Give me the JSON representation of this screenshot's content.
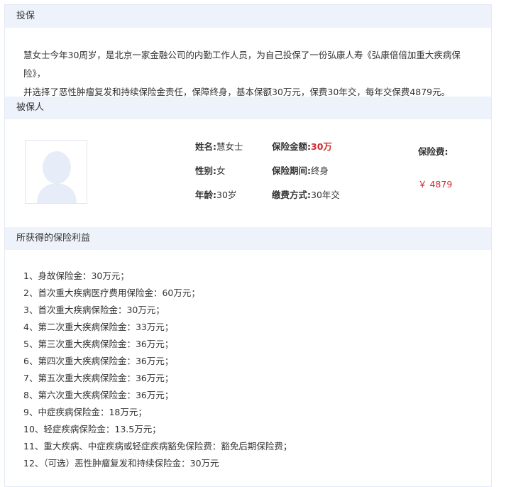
{
  "sections": {
    "toubao": "投保",
    "insured": "被保人",
    "benefits": "所获得的保险利益"
  },
  "intro": {
    "line1": "慧女士今年30周岁，是北京一家金融公司的内勤工作人员，为自己投保了一份弘康人寿《弘康倍倍加重大疾病保险》，",
    "line2": "并选择了恶性肿瘤复发和持续保险金责任，保障终身，基本保额30万元，保费30年交，每年交保费4879元。"
  },
  "insured": {
    "avatar_icon": "person-silhouette-icon",
    "name_label": "姓名:",
    "name_value": "慧女士",
    "gender_label": "性别:",
    "gender_value": "女",
    "age_label": "年龄:",
    "age_value": "30岁",
    "amount_label": "保险金额:",
    "amount_value": "30万",
    "period_label": "保险期间:",
    "period_value": "终身",
    "payment_label": "缴费方式:",
    "payment_value": "30年交",
    "fee_label": "保险费:",
    "fee_value": "￥ 4879"
  },
  "benefit_items": [
    "1、身故保险金：30万元；",
    "2、首次重大疾病医疗费用保险金：60万元；",
    "3、首次重大疾病保险金：30万元；",
    "4、第二次重大疾病保险金：33万元；",
    "5、第三次重大疾病保险金：36万元；",
    "6、第四次重大疾病保险金：36万元；",
    "7、第五次重大疾病保险金：36万元；",
    "8、第六次重大疾病保险金：36万元；",
    "9、中症疾病保险金：18万元；",
    "10、轻症疾病保险金：13.5万元；",
    "11、重大疾病、中症疾病或轻症疾病豁免保险费：豁免后期保险费；",
    "12、（可选）恶性肿瘤复发和持续保险金：30万元"
  ],
  "colors": {
    "header_bg": "#eef3fb",
    "accent_red": "#d22b2b",
    "avatar_fill": "#e6edf8"
  }
}
